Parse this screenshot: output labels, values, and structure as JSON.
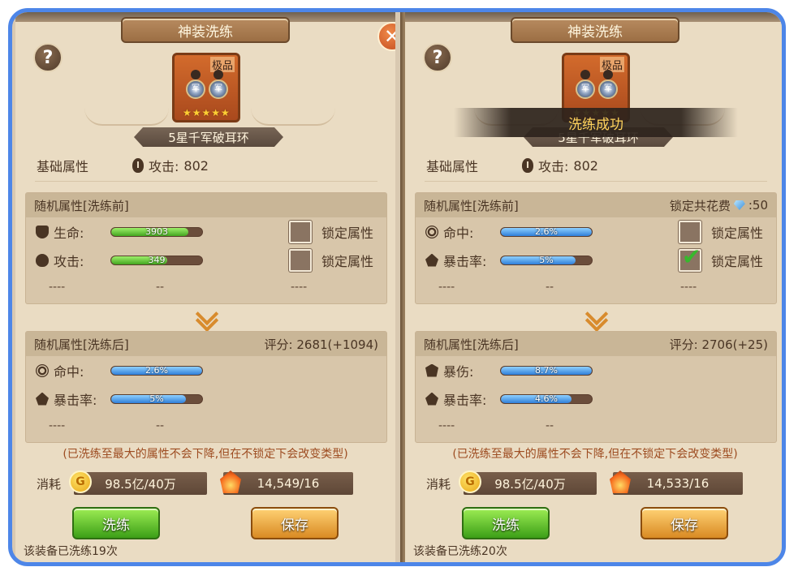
{
  "left": {
    "title": "神装洗练",
    "item": {
      "grade": "极品",
      "name": "5星千军破耳环",
      "stars": "★★★★★",
      "ring_char": "军"
    },
    "base": {
      "label": "基础属性",
      "attr_name": "攻击:",
      "attr_value": "802"
    },
    "before": {
      "title": "随机属性[洗练前]",
      "rows": [
        {
          "name": "生命:",
          "value": "3903",
          "fill": 0.85,
          "color": "green",
          "locked": false,
          "lock_label": "锁定属性"
        },
        {
          "name": "攻击:",
          "value": "349",
          "fill": 0.62,
          "color": "green",
          "locked": false,
          "lock_label": "锁定属性"
        }
      ],
      "dashes": [
        "----",
        "--",
        "----"
      ]
    },
    "after": {
      "title": "随机属性[洗练后]",
      "score": "评分: 2681(+1094)",
      "rows": [
        {
          "name": "命中:",
          "value": "2.6%",
          "fill": 1.0,
          "color": "blue"
        },
        {
          "name": "暴击率:",
          "value": "5%",
          "fill": 0.82,
          "color": "blue"
        }
      ],
      "dashes": [
        "----",
        "--"
      ]
    },
    "note": "(已洗练至最大的属性不会下降,但在不锁定下会改变类型)",
    "cost": {
      "label": "消耗",
      "gold": "98.5亿/40万",
      "stone": "14,549/16"
    },
    "buttons": {
      "refine": "洗练",
      "save": "保存"
    },
    "count": "该装备已洗练19次"
  },
  "right": {
    "title": "神装洗练",
    "item": {
      "grade": "极品",
      "name": "5星千军破耳环",
      "stars": "★★★★★",
      "ring_char": "军"
    },
    "success": "洗练成功",
    "base": {
      "label": "基础属性",
      "attr_name": "攻击:",
      "attr_value": "802"
    },
    "before": {
      "title": "随机属性[洗练前]",
      "lock_cost_label": "锁定共花费",
      "lock_cost_value": ":50",
      "rows": [
        {
          "name": "命中:",
          "value": "2.6%",
          "fill": 1.0,
          "color": "blue",
          "locked": false,
          "lock_label": "锁定属性"
        },
        {
          "name": "暴击率:",
          "value": "5%",
          "fill": 0.82,
          "color": "blue",
          "locked": true,
          "lock_label": "锁定属性"
        }
      ],
      "dashes": [
        "----",
        "--",
        "----"
      ]
    },
    "after": {
      "title": "随机属性[洗练后]",
      "score": "评分: 2706(+25)",
      "rows": [
        {
          "name": "暴伤:",
          "value": "8.7%",
          "fill": 1.0,
          "color": "blue"
        },
        {
          "name": "暴击率:",
          "value": "4.6%",
          "fill": 0.78,
          "color": "blue"
        }
      ],
      "dashes": [
        "----",
        "--"
      ]
    },
    "note": "(已洗练至最大的属性不会下降,但在不锁定下会改变类型)",
    "cost": {
      "label": "消耗",
      "gold": "98.5亿/40万",
      "stone": "14,533/16"
    },
    "buttons": {
      "refine": "洗练",
      "save": "保存"
    },
    "count": "该装备已洗练20次"
  },
  "icons": {
    "help": "?",
    "close": "✕",
    "gold": "G",
    "check": "✔"
  }
}
